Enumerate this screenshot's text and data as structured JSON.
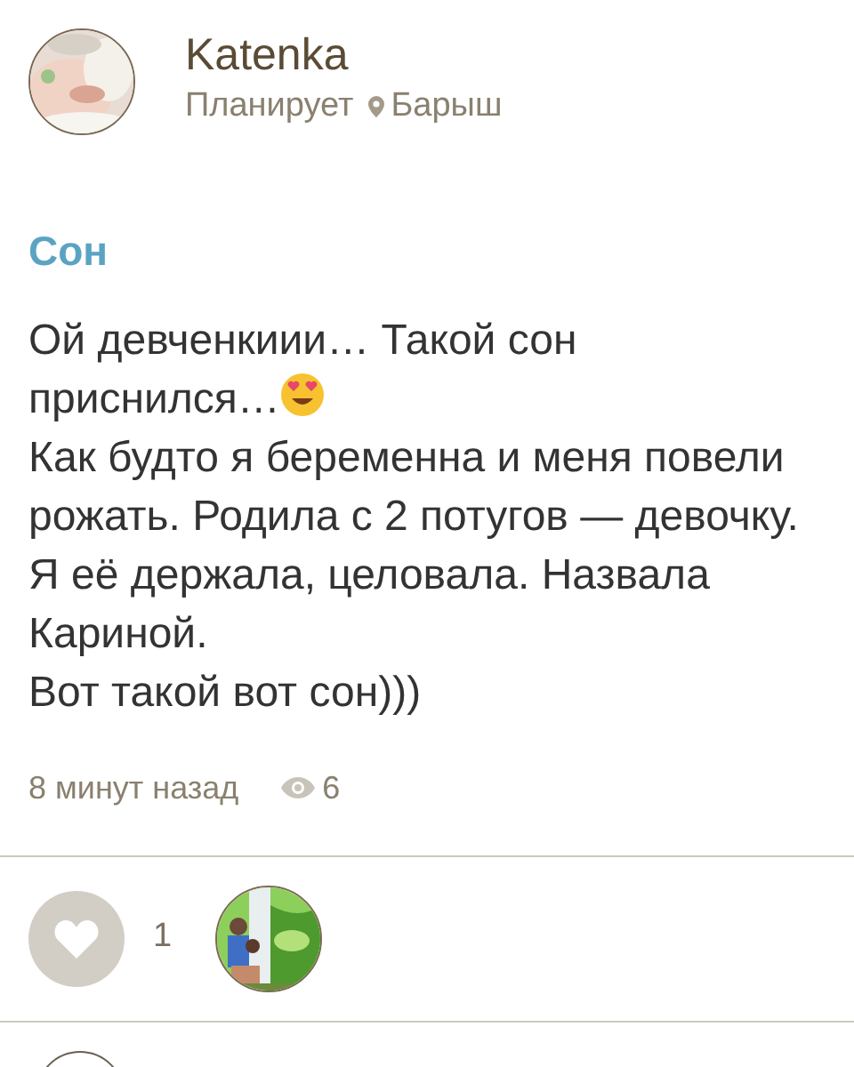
{
  "author": {
    "name": "Katenka",
    "status": "Планирует",
    "location": "Барыш"
  },
  "post": {
    "title": "Сон",
    "paragraphs": [
      {
        "text": "Ой девченкиии… Такой сон приснился…",
        "emoji": true
      },
      {
        "text": "Как будто я беременна и меня повели рожать. Родила с 2 потугов — девочку. Я её держала, целовала. Назвала Кариной.",
        "emoji": false
      },
      {
        "text": "Вот такой вот сон)))",
        "emoji": false
      }
    ],
    "time": "8 минут назад",
    "views": "6"
  },
  "likes": {
    "count": "1",
    "liked": false
  }
}
